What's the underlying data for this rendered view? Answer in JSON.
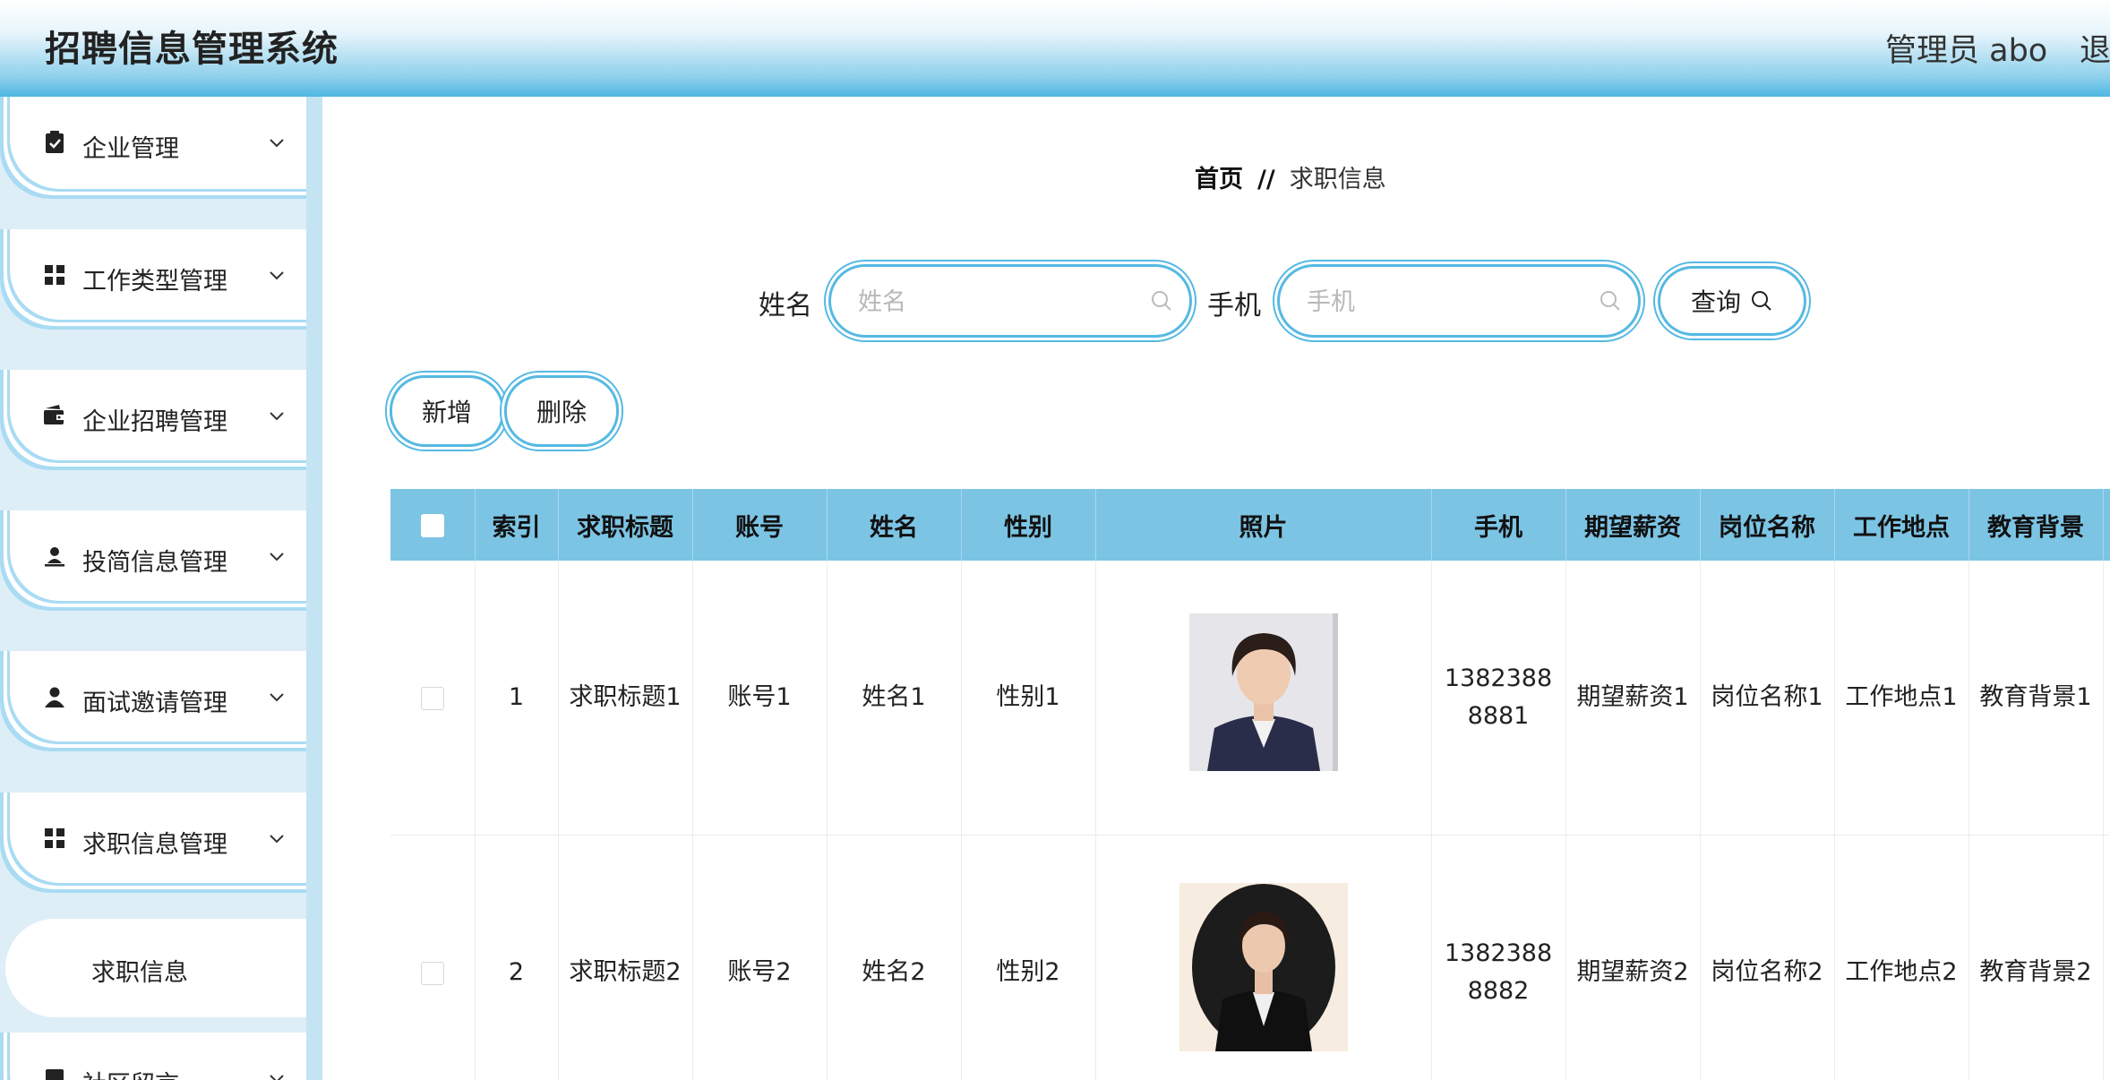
{
  "header": {
    "app_title": "招聘信息管理系统",
    "admin": "管理员 abo",
    "logout": "退出"
  },
  "sidebar": {
    "items": [
      {
        "label": "企业管理",
        "icon": "clipboard-icon"
      },
      {
        "label": "工作类型管理",
        "icon": "grid-icon"
      },
      {
        "label": "企业招聘管理",
        "icon": "wallet-icon"
      },
      {
        "label": "投简信息管理",
        "icon": "user-upload-icon"
      },
      {
        "label": "面试邀请管理",
        "icon": "user-icon"
      },
      {
        "label": "求职信息管理",
        "icon": "grid-icon"
      },
      {
        "label": "社区留言",
        "icon": "chat-icon"
      }
    ],
    "submenu": {
      "label": "求职信息"
    }
  },
  "breadcrumb": {
    "home": "首页",
    "separator": "//",
    "current": "求职信息"
  },
  "search": {
    "name_label": "姓名",
    "name_placeholder": "姓名",
    "phone_label": "手机",
    "phone_placeholder": "手机",
    "query_button": "查询"
  },
  "actions": {
    "add": "新增",
    "delete": "删除"
  },
  "table": {
    "columns": [
      "索引",
      "求职标题",
      "账号",
      "姓名",
      "性别",
      "照片",
      "手机",
      "期望薪资",
      "岗位名称",
      "工作地点",
      "教育背景"
    ],
    "rows": [
      {
        "index": "1",
        "title": "求职标题1",
        "account": "账号1",
        "name": "姓名1",
        "gender": "性别1",
        "phone": "13823888881",
        "salary": "期望薪资1",
        "position": "岗位名称1",
        "location": "工作地点1",
        "education": "教育背景1"
      },
      {
        "index": "2",
        "title": "求职标题2",
        "account": "账号2",
        "name": "姓名2",
        "gender": "性别2",
        "phone": "13823888882",
        "salary": "期望薪资2",
        "position": "岗位名称2",
        "location": "工作地点2",
        "education": "教育背景2"
      }
    ]
  },
  "colors": {
    "accent": "#55b9e2",
    "table_header": "#7cc4e4",
    "sidebar_bg": "#ddeef7"
  }
}
